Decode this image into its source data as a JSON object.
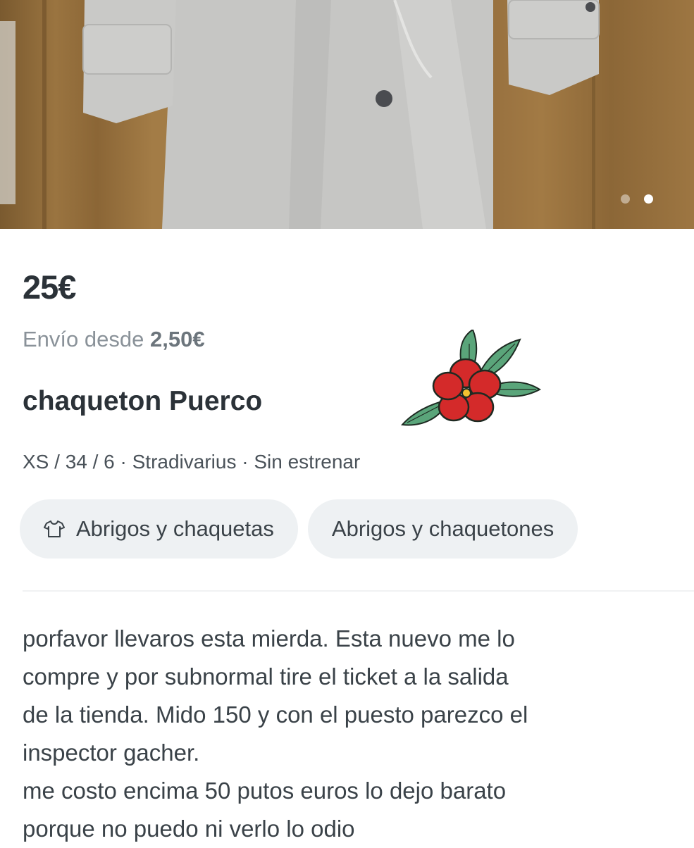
{
  "listing": {
    "price": "25€",
    "shipping_prefix": "Envío desde",
    "shipping_price": "2,50€",
    "title": "chaqueton Puerco",
    "details": "XS / 34 / 6 · Stradivarius · Sin estrenar",
    "categories": [
      "Abrigos y chaquetas",
      "Abrigos y chaquetones"
    ],
    "description_lines": [
      "porfavor llevaros esta mierda. Esta nuevo me lo",
      "compre y por subnormal tire el ticket a la salida",
      "de la tienda. Mido 150 y con el puesto parezco el",
      "inspector gacher.",
      "me costo encima 50 putos euros lo dejo barato",
      "porque no puedo ni verlo lo odio"
    ]
  },
  "gallery": {
    "current_index": 2,
    "total": 2
  },
  "icons": {
    "category": "tshirt-icon",
    "sticker": "flower-sticker"
  },
  "colors": {
    "text": "#2b3238",
    "muted": "#8a9299",
    "chip_bg": "#eef1f3"
  }
}
